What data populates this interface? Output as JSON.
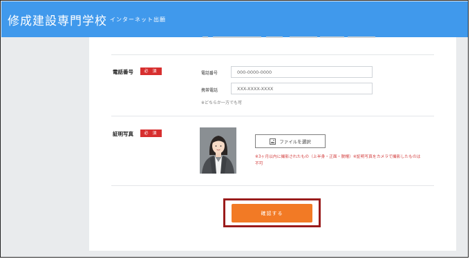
{
  "header": {
    "school_name": "修成建設専門学校",
    "subtitle": "インターネット出願",
    "color": "#4099ec"
  },
  "form": {
    "required_badge": "必 須",
    "phone": {
      "label": "電話番号",
      "home_label": "電話番号",
      "home_placeholder": "000-0000-0000",
      "mobile_label": "携帯電話",
      "mobile_placeholder": "XXX-XXXX-XXXX",
      "note": "※どちらか一方でも可"
    },
    "photo": {
      "label": "証明写真",
      "file_button_label": "ファイルを選択",
      "file_icon": "image-file-icon",
      "warning": "※3ヶ月以内に撮影されたもの（上半身・正面・脱帽）※証明写真をカメラで撮影したものは不可"
    },
    "confirm_label": "確認する",
    "accent_color": "#f27a25",
    "required_color": "#d72f2f",
    "highlight_color": "#9a1b1b"
  }
}
